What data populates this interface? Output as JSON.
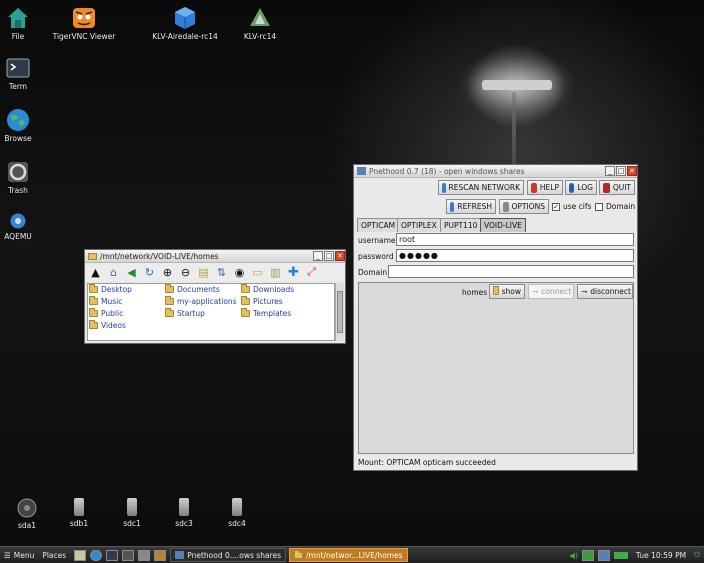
{
  "desktop": {
    "icons": [
      {
        "label": "File",
        "icon": "home-folder-icon",
        "color": "#2aa198"
      },
      {
        "label": "TigerVNC Viewer",
        "icon": "tigervnc-icon",
        "color": "#f08a24"
      },
      {
        "label": "KLV-Airedale-rc14",
        "icon": "cube-icon",
        "color": "#2f7fd6"
      },
      {
        "label": "KLV-rc14",
        "icon": "klv-icon",
        "color": "#6a9a6a"
      },
      {
        "label": "Term",
        "icon": "terminal-icon",
        "color": "#2d3a4a"
      },
      {
        "label": "Browse",
        "icon": "globe-icon",
        "color": "#2a8bd6"
      },
      {
        "label": "Trash",
        "icon": "trash-icon",
        "color": "#bbbbbb"
      },
      {
        "label": "AQEMU",
        "icon": "aqemu-icon",
        "color": "#3b7fd6"
      }
    ],
    "drives": [
      {
        "label": "sda1",
        "icon": "hard-drive-icon"
      },
      {
        "label": "sdb1",
        "icon": "usb-drive-icon"
      },
      {
        "label": "sdc1",
        "icon": "usb-drive-icon"
      },
      {
        "label": "sdc3",
        "icon": "usb-drive-icon"
      },
      {
        "label": "sdc4",
        "icon": "usb-drive-icon"
      }
    ]
  },
  "file_manager": {
    "title": "/mnt/network/VOID-LIVE/homes",
    "toolbar_icons": [
      "up-arrow-icon",
      "home-icon",
      "back-icon",
      "refresh-icon",
      "zoom-in-icon",
      "zoom-out-icon",
      "resize-icon",
      "sort-icon",
      "eye-icon",
      "new-folder-icon",
      "new-file-icon",
      "add-icon",
      "fullscreen-icon"
    ],
    "items": [
      "Desktop",
      "Documents",
      "Downloads",
      "Music",
      "my-applications",
      "Pictures",
      "Public",
      "Startup",
      "Templates",
      "Videos"
    ]
  },
  "pnethood": {
    "title": "Pnethood 0.7 (18) - open windows shares",
    "buttons": {
      "rescan": "RESCAN NETWORK",
      "help": "HELP",
      "log": "LOG",
      "quit": "QUIT",
      "refresh": "REFRESH",
      "options": "OPTIONS"
    },
    "checks": {
      "use_cifs": "use cifs",
      "use_cifs_checked": true,
      "domain": "Domain",
      "domain_checked": false
    },
    "tabs": [
      "OPTICAM",
      "OPTIPLEX",
      "PUPT110",
      "VOID-LIVE"
    ],
    "active_tab": "VOID-LIVE",
    "fields": {
      "username_label": "username",
      "username_value": "root",
      "password_label": "password",
      "password_value": "●●●●●",
      "domain_label": "Domain",
      "domain_value": ""
    },
    "share": {
      "name": "homes",
      "show": "show",
      "connect": "connect",
      "disconnect": "disconnect"
    },
    "status": "Mount: OPTICAM opticam succeeded"
  },
  "taskbar": {
    "menu": "Menu",
    "places": "Places",
    "tasks": [
      "Pnethood 0....ows shares",
      "/mnt/networ...LIVE/homes"
    ],
    "clock": "Tue 10:59 PM"
  }
}
